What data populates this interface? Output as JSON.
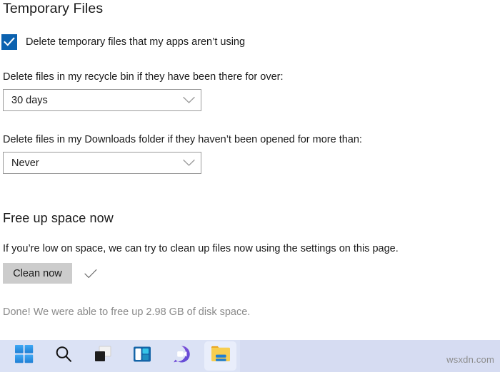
{
  "settings_page": {
    "temporary_files": {
      "title": "Temporary Files",
      "checkbox": {
        "label": "Delete temporary files that my apps aren’t using",
        "checked": true,
        "checked_color": "#0b62b0",
        "icon": "checkmark-icon"
      },
      "recycle_bin": {
        "label": "Delete files in my recycle bin if they have been there for over:",
        "selected_value": "30 days",
        "chevron_icon": "chevron-down-icon"
      },
      "downloads": {
        "label": "Delete files in my Downloads folder if they haven’t been opened for more than:",
        "selected_value": "Never",
        "chevron_icon": "chevron-down-icon"
      }
    },
    "free_up_space": {
      "title": "Free up space now",
      "description": "If you’re low on space, we can try to clean up files now using the settings on this page.",
      "clean_button_label": "Clean now",
      "success_check_icon": "checkmark-icon",
      "status_message": "Done! We were able to free up 2.98 GB of disk space.",
      "status_color": "#8a8a8a",
      "button_color": "#cccccc"
    }
  },
  "taskbar": {
    "background_color": "#d6dcf2",
    "items": [
      {
        "name": "start",
        "icon": "windows-logo-icon",
        "active": false
      },
      {
        "name": "search",
        "icon": "search-icon",
        "active": false
      },
      {
        "name": "task-view",
        "icon": "task-view-icon",
        "active": false
      },
      {
        "name": "widgets",
        "icon": "widgets-icon",
        "active": false
      },
      {
        "name": "chat",
        "icon": "chat-icon",
        "active": false
      },
      {
        "name": "file-explorer",
        "icon": "folder-icon",
        "active": true
      }
    ]
  },
  "watermark": {
    "text": "wsxdn.com"
  }
}
